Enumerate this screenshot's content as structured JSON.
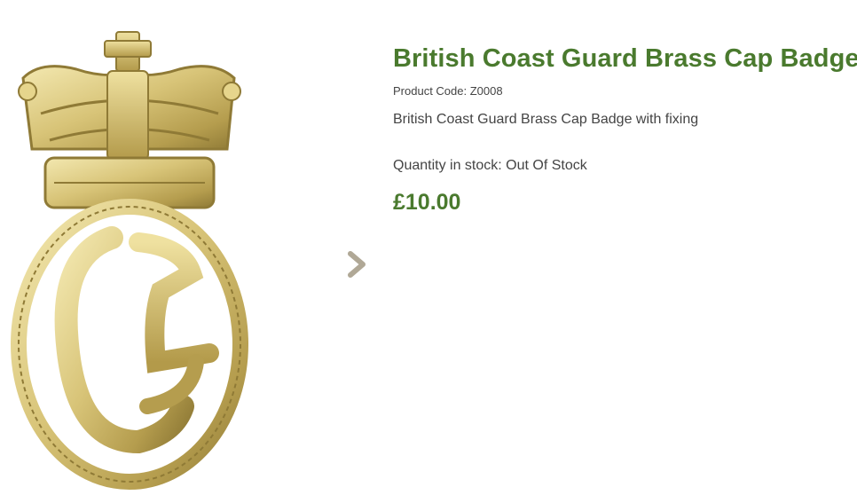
{
  "product": {
    "title": "British Coast Guard Brass Cap Badge",
    "code_label": "Product Code:",
    "code": "Z0008",
    "description": "British Coast Guard Brass Cap Badge with fixing",
    "stock_label": "Quantity in stock:",
    "stock_value": "Out Of Stock",
    "price": "£10.00"
  },
  "gallery": {
    "image_name": "badge-photo",
    "next_icon": "chevron-right-icon"
  },
  "colors": {
    "accent": "#4a7a2e",
    "text": "#444444",
    "arrow": "#b0a896",
    "brass_light": "#efe3a4",
    "brass_mid": "#cdb866",
    "brass_dark": "#8f7a36"
  }
}
